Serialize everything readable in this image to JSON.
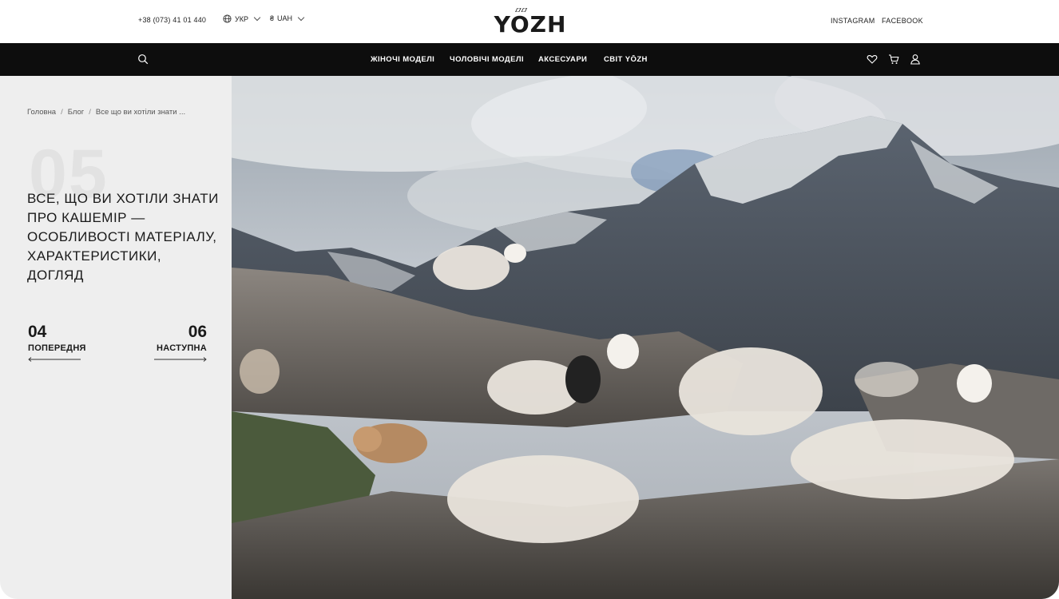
{
  "header": {
    "phone": "+38 (073) 41 01 440",
    "language": "УКР",
    "currency_symbol": "₴",
    "currency": "UAH",
    "logo": "YOZH",
    "instagram": "INSTAGRAM",
    "facebook": "FACEBOOK"
  },
  "nav": {
    "items": [
      {
        "label": "ЖІНОЧІ МОДЕЛІ"
      },
      {
        "label": "ЧОЛОВІЧІ МОДЕЛІ"
      },
      {
        "label": "АКСЕСУАРИ"
      },
      {
        "label": "СВІТ YŌZH"
      }
    ],
    "icons": [
      "search-icon",
      "heart-icon",
      "cart-icon",
      "user-icon"
    ]
  },
  "breadcrumb": {
    "items": [
      "Головна",
      "Блог",
      "Все що ви хотіли знати ..."
    ],
    "separator": "/"
  },
  "article": {
    "number": "05",
    "title": "Все, що ви хотіли знати про кашемір — особливості матеріалу, характеристики, догляд"
  },
  "pager": {
    "prev_number": "04",
    "prev_label": "ПОПЕРЕДНЯ",
    "next_number": "06",
    "next_label": "НАСТУПНА"
  },
  "colors": {
    "nav_bg": "#0d0d0d",
    "sidebar_bg": "#eeeeee",
    "text": "#1a1a1a"
  }
}
